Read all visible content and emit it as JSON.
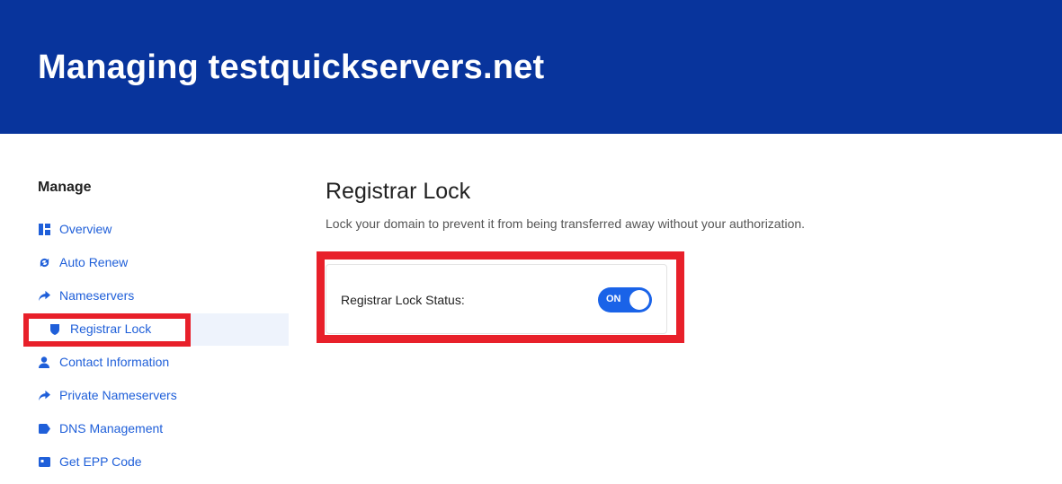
{
  "header": {
    "title": "Managing testquickservers.net"
  },
  "sidebar": {
    "heading": "Manage",
    "items": [
      {
        "label": "Overview",
        "icon": "dashboard-icon"
      },
      {
        "label": "Auto Renew",
        "icon": "refresh-icon"
      },
      {
        "label": "Nameservers",
        "icon": "share-arrow-icon"
      },
      {
        "label": "Registrar Lock",
        "icon": "shield-icon",
        "active": true
      },
      {
        "label": "Contact Information",
        "icon": "user-icon"
      },
      {
        "label": "Private Nameservers",
        "icon": "share-arrow-icon"
      },
      {
        "label": "DNS Management",
        "icon": "tag-icon"
      },
      {
        "label": "Get EPP Code",
        "icon": "id-card-icon"
      }
    ]
  },
  "main": {
    "title": "Registrar Lock",
    "description": "Lock your domain to prevent it from being transferred away without your authorization.",
    "status_label": "Registrar Lock Status:",
    "toggle": {
      "state": "ON",
      "on": true
    }
  },
  "colors": {
    "banner": "#08349c",
    "link": "#1f5fd9",
    "highlight": "#e8202a",
    "toggle": "#1a63e8"
  }
}
